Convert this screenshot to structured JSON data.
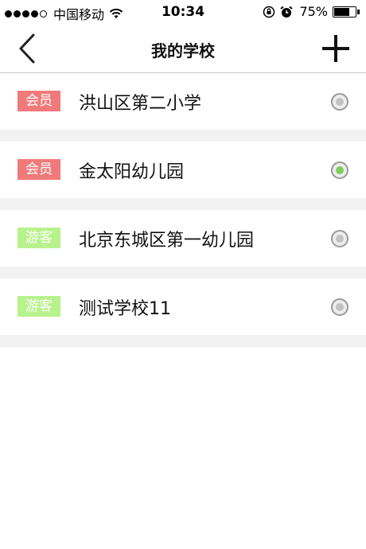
{
  "status_bar": {
    "carrier": "中国移动",
    "time": "10:34",
    "battery_percent": "75%",
    "battery_level": 0.75
  },
  "nav": {
    "title": "我的学校"
  },
  "schools": [
    {
      "badge": "会员",
      "badge_type": "member",
      "name": "洪山区第二小学",
      "selected": false
    },
    {
      "badge": "会员",
      "badge_type": "member",
      "name": "金太阳幼儿园",
      "selected": true
    },
    {
      "badge": "游客",
      "badge_type": "guest",
      "name": "北京东城区第一幼儿园",
      "selected": false
    },
    {
      "badge": "游客",
      "badge_type": "guest",
      "name": "测试学校11",
      "selected": false
    }
  ],
  "colors": {
    "member_badge": "#f07a7a",
    "guest_badge": "#b8f28c",
    "selected_radio": "#7fce5c"
  }
}
